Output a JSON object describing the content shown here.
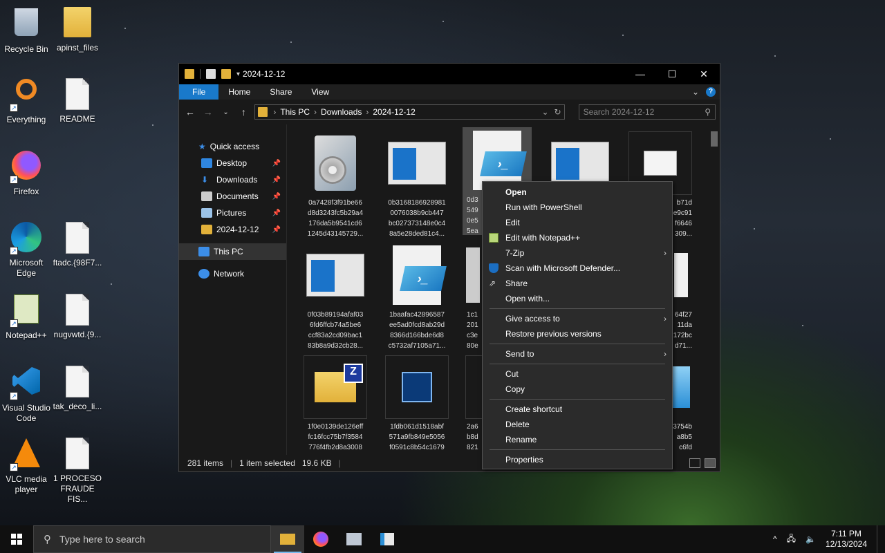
{
  "desktop": {
    "icons": [
      {
        "label": "Recycle Bin"
      },
      {
        "label": "apinst_files"
      },
      {
        "label": "Everything"
      },
      {
        "label": "README"
      },
      {
        "label": "Firefox"
      },
      {
        "label": "Microsoft Edge"
      },
      {
        "label": "ftadc.{98F7..."
      },
      {
        "label": "Notepad++"
      },
      {
        "label": "nugvwtd.{9..."
      },
      {
        "label": "Visual Studio Code"
      },
      {
        "label": "tak_deco_li..."
      },
      {
        "label": "VLC media player"
      },
      {
        "label": "1 PROCESO FRAUDE FIS..."
      }
    ]
  },
  "explorer": {
    "title": "2024-12-12",
    "ribbon_tabs": [
      "File",
      "Home",
      "Share",
      "View"
    ],
    "breadcrumbs": [
      "This PC",
      "Downloads",
      "2024-12-12"
    ],
    "search_placeholder": "Search 2024-12-12",
    "nav": {
      "quick_access": "Quick access",
      "items": [
        "Desktop",
        "Downloads",
        "Documents",
        "Pictures",
        "2024-12-12"
      ],
      "this_pc": "This PC",
      "network": "Network"
    },
    "files": [
      [
        "0a7428f3f91be66",
        "d8d3243fc5b29a4",
        "176da5b9541cd6",
        "1245d43145729..."
      ],
      [
        "0b3168186928981",
        "0076038b9cb447",
        "bc027373148e0c4",
        "8a5e28ded81c4..."
      ],
      [
        "0d3",
        "549",
        "0e5",
        "5ea"
      ],
      [
        "",
        "",
        "",
        ""
      ],
      [
        "b71d",
        "e9c91",
        "f6646",
        "309..."
      ],
      [
        "0f03b89194afaf03",
        "6fd6ffcb74a5be6",
        "ccf83a2cd09bac1",
        "83b8a9d32cb28..."
      ],
      [
        "1baafac42896587",
        "ee5ad0fcd8ab29d",
        "8366d166bde6d8",
        "c5732af7105a71..."
      ],
      [
        "1c1",
        "201",
        "c3e",
        "80e"
      ],
      [
        "",
        "",
        "",
        ""
      ],
      [
        "64f27",
        "11da",
        "172bc",
        "d71..."
      ],
      [
        "1f0e0139de126eff",
        "fc16fcc75b7f3584",
        "776f4fb2d8a3008",
        ""
      ],
      [
        "1fdb061d1518abf",
        "571a9fb849e5056",
        "f0591c8b54c1679",
        ""
      ],
      [
        "2a6",
        "b8d",
        "821",
        ""
      ],
      [
        "",
        "",
        "",
        ""
      ],
      [
        "3754b",
        "a8b5",
        "c6fd",
        ""
      ]
    ],
    "status": {
      "count": "281 items",
      "selected": "1 item selected",
      "size": "19.6 KB"
    }
  },
  "context_menu": {
    "items": [
      {
        "label": "Open",
        "bold": true
      },
      {
        "label": "Run with PowerShell"
      },
      {
        "label": "Edit"
      },
      {
        "label": "Edit with Notepad++"
      },
      {
        "label": "7-Zip"
      },
      {
        "label": "Scan with Microsoft Defender..."
      },
      {
        "label": "Share"
      },
      {
        "label": "Open with..."
      },
      {
        "label": "Give access to"
      },
      {
        "label": "Restore previous versions"
      },
      {
        "label": "Send to"
      },
      {
        "label": "Cut"
      },
      {
        "label": "Copy"
      },
      {
        "label": "Create shortcut"
      },
      {
        "label": "Delete"
      },
      {
        "label": "Rename"
      },
      {
        "label": "Properties"
      }
    ]
  },
  "taskbar": {
    "search_placeholder": "Type here to search",
    "time": "7:11 PM",
    "date": "12/13/2024"
  },
  "colors": {
    "accent": "#1979ca",
    "folder": "#e2b13a"
  }
}
